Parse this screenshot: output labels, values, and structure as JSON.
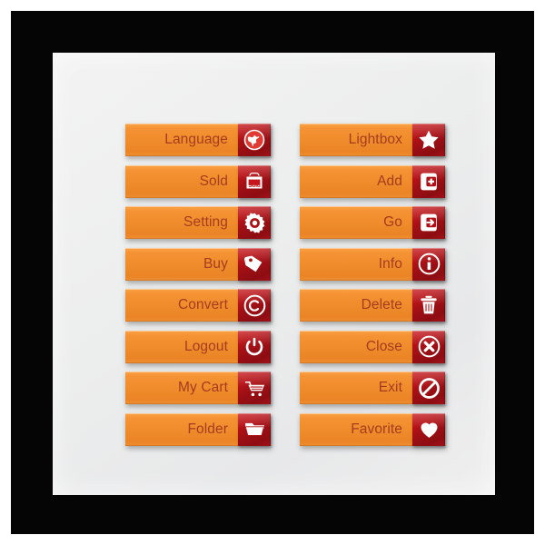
{
  "artboard": {
    "frame_color": "#050506",
    "panel_color": "#ecedee",
    "button_orange": "#ef8b2a",
    "label_color": "#a53c20",
    "icon_red": "#b51217",
    "icon_glyph_color": "#ffffff"
  },
  "columns": [
    {
      "name": "left-column",
      "buttons": [
        {
          "label": "Language",
          "icon": "globe-icon"
        },
        {
          "label": "Sold",
          "icon": "sold-sign-icon",
          "icon_text": "Sold"
        },
        {
          "label": "Setting",
          "icon": "gear-icon"
        },
        {
          "label": "Buy",
          "icon": "price-tag-icon"
        },
        {
          "label": "Convert",
          "icon": "copyright-icon"
        },
        {
          "label": "Logout",
          "icon": "power-icon"
        },
        {
          "label": "My Cart",
          "icon": "shopping-cart-icon"
        },
        {
          "label": "Folder",
          "icon": "folder-icon"
        }
      ]
    },
    {
      "name": "right-column",
      "buttons": [
        {
          "label": "Lightbox",
          "icon": "star-icon"
        },
        {
          "label": "Add",
          "icon": "add-to-box-icon"
        },
        {
          "label": "Go",
          "icon": "arrow-into-box-icon"
        },
        {
          "label": "Info",
          "icon": "info-circle-icon"
        },
        {
          "label": "Delete",
          "icon": "trash-icon"
        },
        {
          "label": "Close",
          "icon": "close-circle-icon"
        },
        {
          "label": "Exit",
          "icon": "no-entry-icon"
        },
        {
          "label": "Favorite",
          "icon": "heart-icon"
        }
      ]
    }
  ]
}
